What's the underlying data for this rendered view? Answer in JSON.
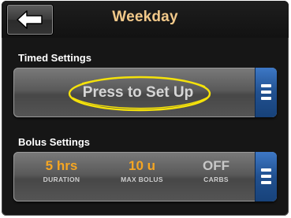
{
  "header": {
    "title": "Weekday",
    "back_icon": "arrow-left-icon"
  },
  "timed_settings": {
    "label": "Timed Settings",
    "prompt": "Press to Set Up",
    "menu_icon": "menu-icon"
  },
  "bolus_settings": {
    "label": "Bolus Settings",
    "menu_icon": "menu-icon",
    "stats": [
      {
        "value": "5 hrs",
        "label": "DURATION",
        "color": "#f5a623"
      },
      {
        "value": "10 u",
        "label": "MAX BOLUS",
        "color": "#f5a623"
      },
      {
        "value": "OFF",
        "label": "CARBS",
        "color": "#c8c8c8"
      }
    ]
  },
  "colors": {
    "title": "#f2c98a",
    "accent_orange": "#f5a623",
    "menu_blue": "#21508f",
    "highlight_circle": "#f5e20a"
  }
}
